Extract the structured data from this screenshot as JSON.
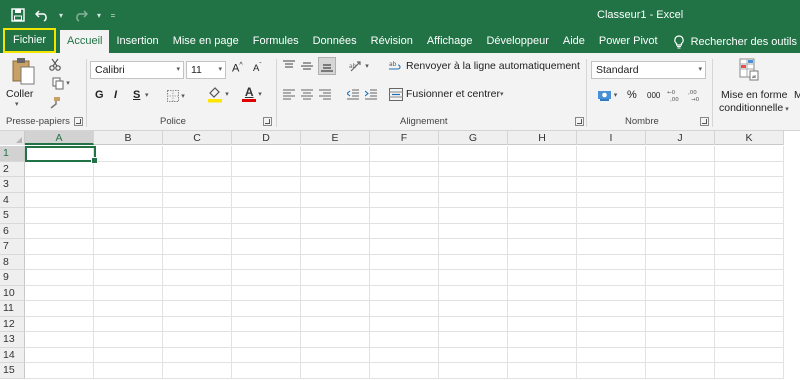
{
  "window": {
    "title": "Classeur1  -  Excel"
  },
  "quick_access": {
    "save": "save-icon",
    "undo": "undo-icon",
    "redo": "redo-icon"
  },
  "tabs": [
    {
      "label": "Fichier",
      "highlighted": true
    },
    {
      "label": "Accueil",
      "active": true
    },
    {
      "label": "Insertion"
    },
    {
      "label": "Mise en page"
    },
    {
      "label": "Formules"
    },
    {
      "label": "Données"
    },
    {
      "label": "Révision"
    },
    {
      "label": "Affichage"
    },
    {
      "label": "Développeur"
    },
    {
      "label": "Aide"
    },
    {
      "label": "Power Pivot"
    }
  ],
  "tell_me": {
    "label": "Rechercher des outils adaptés"
  },
  "ribbon": {
    "clipboard": {
      "paste_label": "Coller",
      "group_label": "Presse-papiers"
    },
    "font": {
      "font_name": "Calibri",
      "font_size": "11",
      "bold": "G",
      "italic": "I",
      "underline": "S",
      "grow": "A",
      "shrink": "A",
      "font_color_letter": "A",
      "group_label": "Police"
    },
    "alignment": {
      "wrap_label": "Renvoyer à la ligne automatiquement",
      "merge_label": "Fusionner et centrer",
      "group_label": "Alignement"
    },
    "number": {
      "format": "Standard",
      "percent": "%",
      "thousands": "000",
      "group_label": "Nombre"
    },
    "styles": {
      "cond_format_line1": "Mise en forme",
      "cond_format_line2": "conditionnelle",
      "next_partial": "M"
    }
  },
  "sheet": {
    "columns": [
      "A",
      "B",
      "C",
      "D",
      "E",
      "F",
      "G",
      "H",
      "I",
      "J",
      "K"
    ],
    "rows": [
      "1",
      "2",
      "3",
      "4",
      "5",
      "6",
      "7",
      "8",
      "9",
      "10",
      "11",
      "12",
      "13",
      "14",
      "15"
    ],
    "active_cell": "A1"
  },
  "colors": {
    "brand": "#217346",
    "highlight": "#f2e600"
  }
}
